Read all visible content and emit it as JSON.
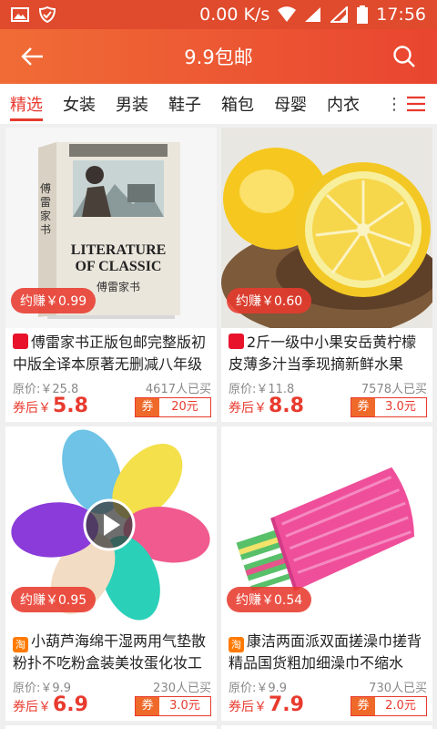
{
  "status_bar": {
    "speed": "0.00 K/s",
    "time": "17:56"
  },
  "app_bar": {
    "title": "9.9包邮"
  },
  "tabs": [
    {
      "label": "精选"
    },
    {
      "label": "女装"
    },
    {
      "label": "男装"
    },
    {
      "label": "鞋子"
    },
    {
      "label": "箱包"
    },
    {
      "label": "母婴"
    },
    {
      "label": "内衣"
    }
  ],
  "tabs_more": "⋮",
  "cover_text": {
    "vertical_title": "傅雷家书",
    "line1": "LITERATURE",
    "line2": "OF CLASSIC",
    "subtitle": "傅雷家书"
  },
  "products": [
    {
      "earn": "约赚￥0.99",
      "platform": "tmall",
      "platform_glyph": "",
      "title": "傅雷家书正版包邮完整版初中版全译本原著无删减八年级下册必读课外阅读",
      "orig_price": "原价:￥25.8",
      "sold": "4617人已买",
      "after_label": "券后￥",
      "after_price": "5.8",
      "coupon_label": "券",
      "coupon_value": "20元"
    },
    {
      "earn": "约赚￥0.60",
      "platform": "tmall",
      "platform_glyph": "",
      "title": "2斤一级中小果安岳黄柠檬皮薄多汁当季现摘新鲜水果",
      "orig_price": "原价:￥11.8",
      "sold": "7578人已买",
      "after_label": "券后￥",
      "after_price": "8.8",
      "coupon_label": "券",
      "coupon_value": "3.0元"
    },
    {
      "earn": "约赚￥0.95",
      "platform": "taobao",
      "platform_glyph": "淘",
      "title": "小葫芦海绵干湿两用气垫散粉扑不吃粉盒装美妆蛋化妆工具",
      "orig_price": "原价:￥9.9",
      "sold": "230人已买",
      "after_label": "券后￥",
      "after_price": "6.9",
      "coupon_label": "券",
      "coupon_value": "3.0元"
    },
    {
      "earn": "约赚￥0.54",
      "platform": "taobao",
      "platform_glyph": "淘",
      "title": "康洁两面派双面搓澡巾搓背精品国货粗加细澡巾不缩水",
      "orig_price": "原价:￥9.9",
      "sold": "730人已买",
      "after_label": "券后￥",
      "after_price": "7.9",
      "coupon_label": "券",
      "coupon_value": "2.0元"
    }
  ],
  "colors": {
    "accent": "#e83a2e",
    "status_bar": "#e04a2d",
    "tmall": "#e8132b",
    "taobao": "#ff7a00"
  },
  "icons": {
    "back": "back-arrow-icon",
    "search": "search-icon",
    "menu": "menu-icon",
    "play": "play-icon"
  }
}
